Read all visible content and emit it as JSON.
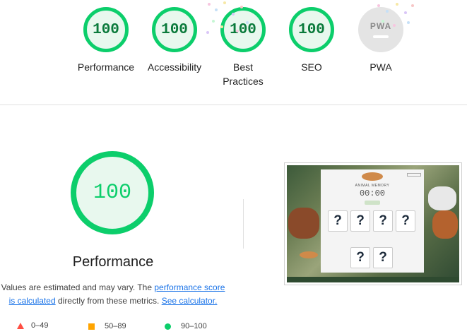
{
  "categories": [
    {
      "label": "Performance",
      "score": "100",
      "status": "pass"
    },
    {
      "label": "Accessibility",
      "score": "100",
      "status": "pass"
    },
    {
      "label": "Best\nPractices",
      "score": "100",
      "status": "pass"
    },
    {
      "label": "SEO",
      "score": "100",
      "status": "pass"
    },
    {
      "label": "PWA",
      "score": "PWA",
      "status": "na"
    }
  ],
  "main": {
    "score": "100",
    "title": "Performance",
    "desc_prefix": "Values are estimated and may vary. The ",
    "desc_link1": "performance score is calculated",
    "desc_middle": " directly from these metrics. ",
    "desc_link2": "See calculator."
  },
  "legend": [
    {
      "range": "0–49",
      "color": "#ff4e42"
    },
    {
      "range": "50–89",
      "color": "#ffa400"
    },
    {
      "range": "90–100",
      "color": "#0cce6b"
    }
  ],
  "screenshot": {
    "title": "ANIMAL MEMORY",
    "timer": "00:00",
    "start_label": "Start Game",
    "how_label": "How to Play",
    "card_glyph": "?"
  },
  "colors": {
    "pass": "#0cce6b",
    "average": "#ffa400",
    "fail": "#ff4e42",
    "link": "#1a73e8"
  }
}
